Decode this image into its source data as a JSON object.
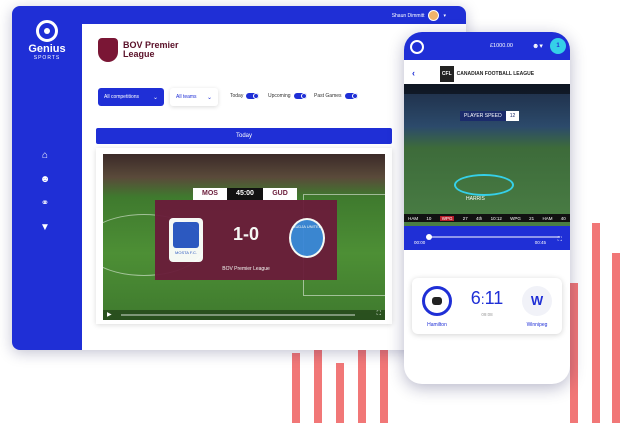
{
  "colors": {
    "brand": "#1f2fd6",
    "accent_red": "#f06868",
    "league": "#6a1c3a",
    "cyan": "#35d0e8"
  },
  "desktop": {
    "brand": {
      "name": "Genius",
      "sub": "SPORTS"
    },
    "user": {
      "name": "Shaun Dimmitt"
    },
    "sidebar": {
      "icons": [
        "home-icon",
        "users-icon",
        "share-icon",
        "filter-icon"
      ]
    },
    "league_name": "BOV Premier League",
    "filters": {
      "competitions": "All competitions",
      "teams": "All teams"
    },
    "toggles": {
      "today": "Today",
      "upcoming": "Upcoming",
      "past": "Past Games"
    },
    "section_title": "Today",
    "match": {
      "home_code": "MOS",
      "away_code": "GUD",
      "clock": "45:00",
      "score": "1-0",
      "caption": "BOV Premier League",
      "home_badge_text": "MOSTA F.C.",
      "away_badge_text": "GUDJA UNITED"
    }
  },
  "phone": {
    "balance": "£1000.00",
    "notifications": "1",
    "league": "CANADIAN FOOTBALL LEAGUE",
    "league_abbr": "CFL",
    "stat_label": "PLAYER SPEED",
    "stat_value": "12",
    "player_name": "HARRIS",
    "scorebug": {
      "away": "HAM",
      "away_score": "10",
      "home": "WPG",
      "home_score": "27",
      "quarter": "4th",
      "clock": "10:12",
      "home_short": "WPG",
      "home_pts": "21",
      "away_short": "HAM",
      "away_pts": "40"
    },
    "time_start": "00:00",
    "time_end": "00:45",
    "card": {
      "home_score": "6",
      "away_score": "11",
      "clock": "09:08",
      "home": "Hamilton",
      "away": "Winnipeg"
    }
  }
}
